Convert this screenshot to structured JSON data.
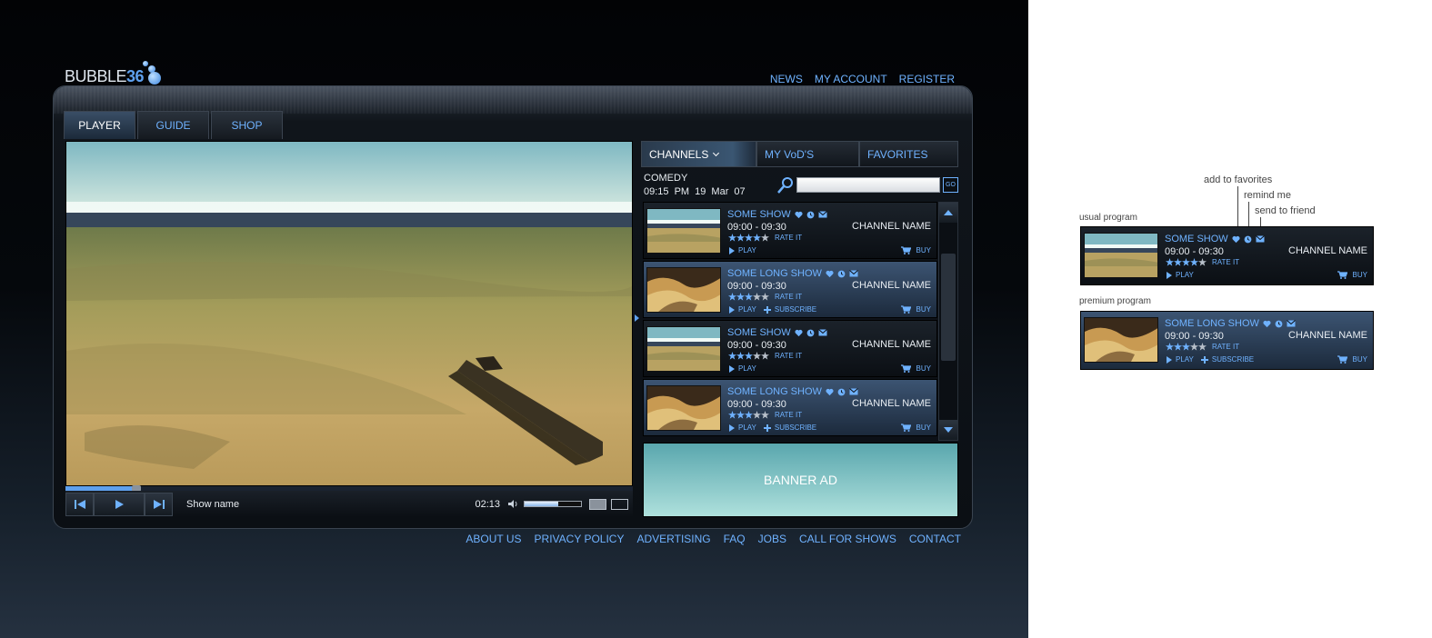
{
  "app": {
    "logo_text": "BUBBLE",
    "logo_num": "36",
    "top_nav": [
      "NEWS",
      "MY ACCOUNT",
      "REGISTER"
    ],
    "tabs": [
      {
        "label": "PLAYER",
        "active": true
      },
      {
        "label": "GUIDE",
        "active": false
      },
      {
        "label": "SHOP",
        "active": false
      }
    ]
  },
  "player": {
    "show_name": "Show name",
    "time_code": "02:13",
    "progress": 0.12,
    "volume": 0.6
  },
  "guide": {
    "tabs": [
      {
        "label": "CHANNELS",
        "active": true
      },
      {
        "label": "MY VoD'S",
        "active": false
      },
      {
        "label": "FAVORITES",
        "active": false
      }
    ],
    "genre": "COMEDY",
    "date": "09:15 PM   19 Mar 07",
    "search": {
      "value": "",
      "go_label": "GO"
    },
    "programs": [
      {
        "title": "SOME SHOW",
        "time": "09:00 - 09:30",
        "channel": "CHANNEL NAME",
        "rating": 4,
        "rate_label": "RATE IT",
        "play_label": "PLAY",
        "subscribe_label": "",
        "buy_label": "BUY",
        "premium": false,
        "thumb": "sea"
      },
      {
        "title": "SOME LONG SHOW",
        "time": "09:00 - 09:30",
        "channel": "CHANNEL NAME",
        "rating": 3,
        "rate_label": "RATE IT",
        "play_label": "PLAY",
        "subscribe_label": "SUBSCRIBE",
        "buy_label": "BUY",
        "premium": true,
        "thumb": "dune"
      },
      {
        "title": "SOME SHOW",
        "time": "09:00 - 09:30",
        "channel": "CHANNEL NAME",
        "rating": 3,
        "rate_label": "RATE IT",
        "play_label": "PLAY",
        "subscribe_label": "",
        "buy_label": "BUY",
        "premium": false,
        "thumb": "sea"
      },
      {
        "title": "SOME LONG SHOW",
        "time": "09:00 - 09:30",
        "channel": "CHANNEL NAME",
        "rating": 3,
        "rate_label": "RATE IT",
        "play_label": "PLAY",
        "subscribe_label": "SUBSCRIBE",
        "buy_label": "BUY",
        "premium": true,
        "thumb": "dune"
      }
    ],
    "banner": "BANNER AD"
  },
  "footer_nav": [
    "ABOUT US",
    "PRIVACY POLICY",
    "ADVERTISING",
    "FAQ",
    "JOBS",
    "CALL FOR SHOWS",
    "CONTACT"
  ],
  "annotations": {
    "add_to_favorites": "add to favorites",
    "remind_me": "remind me",
    "send_to_friend": "send to friend",
    "usual_program": "usual program",
    "premium_program": "premium program",
    "usual": {
      "title": "SOME SHOW",
      "time": "09:00 - 09:30",
      "channel": "CHANNEL NAME",
      "rating": 4,
      "rate_label": "RATE IT",
      "play_label": "PLAY",
      "subscribe_label": "",
      "buy_label": "BUY",
      "premium": false,
      "thumb": "sea"
    },
    "premium": {
      "title": "SOME LONG SHOW",
      "time": "09:00 - 09:30",
      "channel": "CHANNEL NAME",
      "rating": 3,
      "rate_label": "RATE IT",
      "play_label": "PLAY",
      "subscribe_label": "SUBSCRIBE",
      "buy_label": "BUY",
      "premium": true,
      "thumb": "dune"
    }
  },
  "colors": {
    "accent": "#6fb2ff",
    "premium_bg": "#3c5472",
    "banner": "#7cc2c4"
  }
}
